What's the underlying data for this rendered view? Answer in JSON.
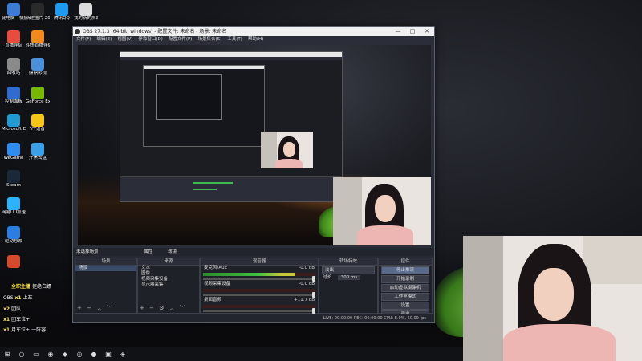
{
  "desktop": {
    "icons": [
      {
        "label": "此电脑 - 快捷方式",
        "color": "#3c7bd6"
      },
      {
        "label": "新建图片 2021050...",
        "color": "#2a2a2a"
      },
      {
        "label": "腾讯QQ",
        "color": "#1d9bf0"
      },
      {
        "label": "我的新的屏幕 快导",
        "color": "#dddddd"
      },
      {
        "label": "直播伴侣",
        "color": "#e84c3d"
      },
      {
        "label": "斗鱼直播伴侣",
        "color": "#f28a1e"
      },
      {
        "label": "回收站",
        "color": "#8a8a8a"
      },
      {
        "label": "鼎鼎影视",
        "color": "#4a90d9"
      },
      {
        "label": "控制面板",
        "color": "#2f6bd1"
      },
      {
        "label": "GeForce Experience",
        "color": "#76b900"
      },
      {
        "label": "Microsoft Edge",
        "color": "#1f9bd1"
      },
      {
        "label": "YY语音",
        "color": "#f5c518"
      },
      {
        "label": "WeGame",
        "color": "#2e8cf0"
      },
      {
        "label": "开黑云盘",
        "color": "#3aa0e8"
      },
      {
        "label": "Steam",
        "color": "#1b2838"
      },
      {
        "label": "网易UU加速器",
        "color": "#2bb3ff"
      },
      {
        "label": "驱动总裁",
        "color": "#2a7de1"
      },
      {
        "label": "",
        "color": "#d64a2c"
      }
    ]
  },
  "overlay": {
    "lines": [
      {
        "pre": "",
        "hl": "全职主播 ",
        "post": "拒绝白嫖"
      },
      {
        "pre": "OBS ",
        "hl": "x1 ",
        "post": "上车"
      },
      {
        "pre": "",
        "hl": "x2 ",
        "post": "团队"
      },
      {
        "pre": "",
        "hl": "x1 ",
        "post": "团车位+"
      },
      {
        "pre": "",
        "hl": "x1 ",
        "post": "月车位+ 一阵容"
      }
    ]
  },
  "obs": {
    "title": "OBS 27.1.3 (64-bit, windows) - 配置文件: 未命名 - 场景: 未命名",
    "window_buttons": [
      "—",
      "□",
      "✕"
    ],
    "menu": [
      "文件(F)",
      "编辑(E)",
      "视图(V)",
      "停靠窗口(D)",
      "配置文件(P)",
      "场景集合(S)",
      "工具(T)",
      "帮助(H)"
    ],
    "scene_bar": {
      "label": "未选择场景",
      "btn1": "属性",
      "btn2": "滤镜"
    },
    "panels": {
      "scenes": {
        "header": "场景",
        "items": [
          "场景"
        ]
      },
      "sources": {
        "header": "来源",
        "items": [
          "文本",
          "图像",
          "视频采集设备",
          "显示器采集"
        ]
      },
      "mixer": {
        "header": "混音器",
        "channels": [
          {
            "name": "麦克风/Aux",
            "db": "-0.0 dB",
            "level": 0.82
          },
          {
            "name": "视频采集设备",
            "db": "-0.0 dB",
            "level": 0.0
          },
          {
            "name": "桌面音频",
            "db": "+11.7 dB",
            "level": 0.0
          }
        ]
      },
      "transitions": {
        "header": "转场特效",
        "type": "淡出",
        "duration_label": "时长",
        "duration": "300 ms"
      },
      "controls": {
        "header": "控件",
        "buttons": [
          "停止推流",
          "开始录制",
          "启动虚拟摄像机",
          "工作室模式",
          "设置",
          "退出"
        ]
      }
    },
    "status": "LIVE: 00:00:00   REC: 00:00:00   CPU: 8.0%, 60.00 fps"
  },
  "taskbar": {
    "items": [
      "⊞",
      "○",
      "▭",
      "◉",
      "◆",
      "◎",
      "●",
      "▣",
      "◈"
    ]
  }
}
